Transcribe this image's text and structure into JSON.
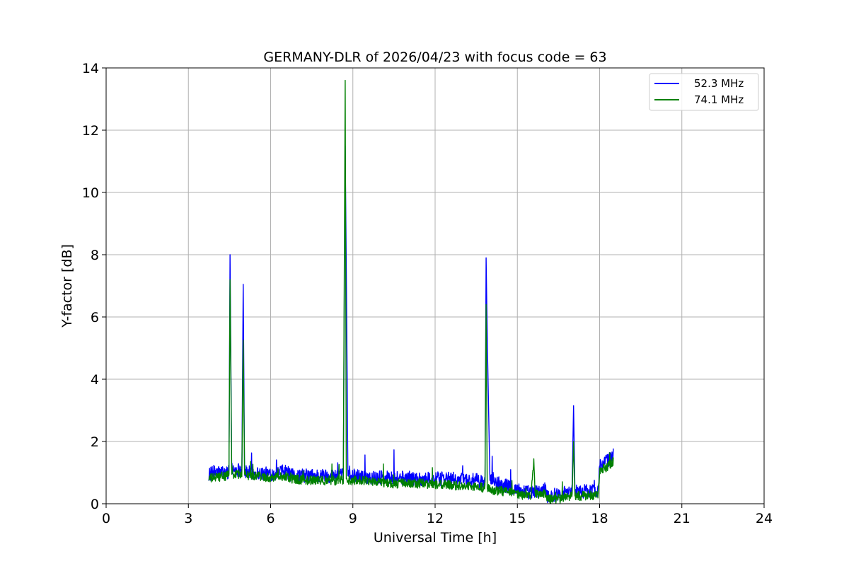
{
  "chart_data": {
    "type": "line",
    "title": "GERMANY-DLR of 2026/04/23 with focus code = 63",
    "xlabel": "Universal Time [h]",
    "ylabel": "Y-factor [dB]",
    "xlim": [
      0,
      24
    ],
    "ylim": [
      0,
      14
    ],
    "xticks": [
      0,
      3,
      6,
      9,
      12,
      15,
      18,
      21,
      24
    ],
    "yticks": [
      0,
      2,
      4,
      6,
      8,
      10,
      12,
      14
    ],
    "xtick_labels": [
      "0",
      "3",
      "6",
      "9",
      "12",
      "15",
      "18",
      "21",
      "24"
    ],
    "ytick_labels": [
      "0",
      "2",
      "4",
      "6",
      "8",
      "10",
      "12",
      "14"
    ],
    "grid": true,
    "legend_position": "top-right",
    "series": [
      {
        "name": "52.3 MHz",
        "color": "#0000ff",
        "noise_amplitude": 0.45,
        "x": [
          3.75,
          4.0,
          4.4,
          4.48,
          4.52,
          4.58,
          4.9,
          4.95,
          5.0,
          5.05,
          5.2,
          6.0,
          6.6,
          6.7,
          7.5,
          8.0,
          8.65,
          8.72,
          8.76,
          8.82,
          9.0,
          9.5,
          10.5,
          11.5,
          12.5,
          13.5,
          13.82,
          13.86,
          13.9,
          14.0,
          14.5,
          15.0,
          15.5,
          16.0,
          16.1,
          16.5,
          17.0,
          17.05,
          17.1,
          17.5,
          17.95,
          18.0,
          18.3,
          18.5
        ],
        "y": [
          0.95,
          1.0,
          1.0,
          1.05,
          8.0,
          1.1,
          1.1,
          1.0,
          7.05,
          1.0,
          1.0,
          0.95,
          1.05,
          0.9,
          0.9,
          0.9,
          0.9,
          11.5,
          7.5,
          0.9,
          0.9,
          0.85,
          0.85,
          0.8,
          0.8,
          0.75,
          0.7,
          7.9,
          5.4,
          0.75,
          0.6,
          0.45,
          0.35,
          0.45,
          0.25,
          0.3,
          0.45,
          3.15,
          0.4,
          0.4,
          0.45,
          1.2,
          1.4,
          1.55
        ]
      },
      {
        "name": "74.1 MHz",
        "color": "#008000",
        "noise_amplitude": 0.3,
        "x": [
          3.75,
          4.0,
          4.4,
          4.48,
          4.52,
          4.58,
          4.9,
          4.95,
          5.0,
          5.05,
          5.2,
          6.0,
          6.6,
          6.7,
          7.5,
          8.0,
          8.65,
          8.72,
          8.76,
          8.82,
          9.0,
          9.5,
          10.5,
          11.5,
          12.5,
          13.5,
          13.82,
          13.86,
          13.9,
          14.0,
          14.5,
          15.0,
          15.5,
          15.6,
          15.65,
          16.0,
          16.1,
          16.5,
          17.0,
          17.05,
          17.1,
          17.5,
          17.95,
          18.0,
          18.3,
          18.5
        ],
        "y": [
          0.8,
          0.85,
          0.9,
          0.9,
          7.2,
          0.95,
          0.95,
          0.9,
          5.25,
          0.95,
          0.9,
          0.85,
          0.9,
          0.8,
          0.75,
          0.75,
          0.75,
          13.6,
          0.8,
          0.75,
          0.75,
          0.75,
          0.65,
          0.65,
          0.6,
          0.55,
          0.5,
          6.4,
          0.5,
          0.45,
          0.4,
          0.3,
          0.25,
          1.4,
          0.3,
          0.3,
          0.15,
          0.15,
          0.25,
          2.0,
          0.25,
          0.25,
          0.3,
          1.05,
          1.2,
          1.35
        ]
      }
    ]
  }
}
